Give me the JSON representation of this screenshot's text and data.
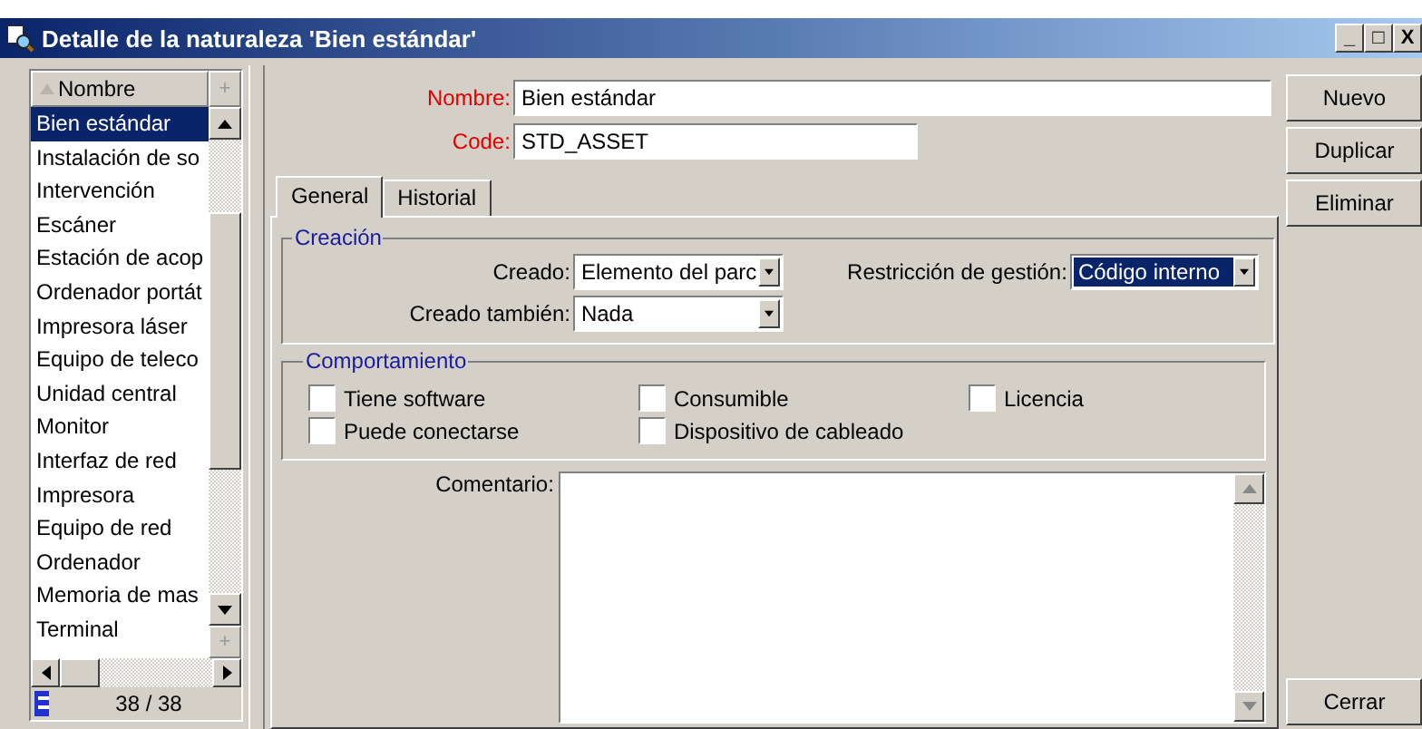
{
  "window": {
    "title": "Detalle de la naturaleza 'Bien estándar'",
    "controls": [
      "_",
      "□",
      "X"
    ]
  },
  "list": {
    "header": "Nombre",
    "header_button": "+",
    "footer_button": "+",
    "count": "38 / 38",
    "items": [
      {
        "label": "Bien estándar",
        "selected": true
      },
      {
        "label": "Instalación de so",
        "selected": false
      },
      {
        "label": "Intervención",
        "selected": false
      },
      {
        "label": "Escáner",
        "selected": false
      },
      {
        "label": "Estación de acop",
        "selected": false
      },
      {
        "label": "Ordenador portát",
        "selected": false
      },
      {
        "label": "Impresora láser",
        "selected": false
      },
      {
        "label": "Equipo de teleco",
        "selected": false
      },
      {
        "label": "Unidad central",
        "selected": false
      },
      {
        "label": "Monitor",
        "selected": false
      },
      {
        "label": "Interfaz de red",
        "selected": false
      },
      {
        "label": "Impresora",
        "selected": false
      },
      {
        "label": "Equipo de red",
        "selected": false
      },
      {
        "label": "Ordenador",
        "selected": false
      },
      {
        "label": "Memoria de mas",
        "selected": false
      },
      {
        "label": "Terminal",
        "selected": false
      }
    ]
  },
  "fields": [
    {
      "label": "Nombre:",
      "value": "Bien estándar",
      "kind": "wide"
    },
    {
      "label": "Code:",
      "value": "STD_ASSET",
      "kind": "short"
    }
  ],
  "tabs": [
    {
      "label": "General",
      "selected": true
    },
    {
      "label": "Historial",
      "selected": false
    }
  ],
  "creacion": {
    "title": "Creación",
    "dropdowns": [
      {
        "label": "Creado:",
        "value": "Elemento del parc",
        "focused": false
      },
      {
        "label": "Restricción de gestión:",
        "value": "Código interno",
        "focused": true
      },
      {
        "label": "Creado también:",
        "value": "Nada",
        "focused": false
      }
    ]
  },
  "comportamiento": {
    "title": "Comportamiento",
    "checkboxes": [
      {
        "label": "Tiene software",
        "checked": false
      },
      {
        "label": "Consumible",
        "checked": false
      },
      {
        "label": "Licencia",
        "checked": false
      },
      {
        "label": "Puede conectarse",
        "checked": false
      },
      {
        "label": "Dispositivo de cableado",
        "checked": false
      }
    ]
  },
  "comment": {
    "label": "Comentario:"
  },
  "buttons": [
    "Nuevo",
    "Duplicar",
    "Eliminar"
  ],
  "close_button": "Cerrar"
}
